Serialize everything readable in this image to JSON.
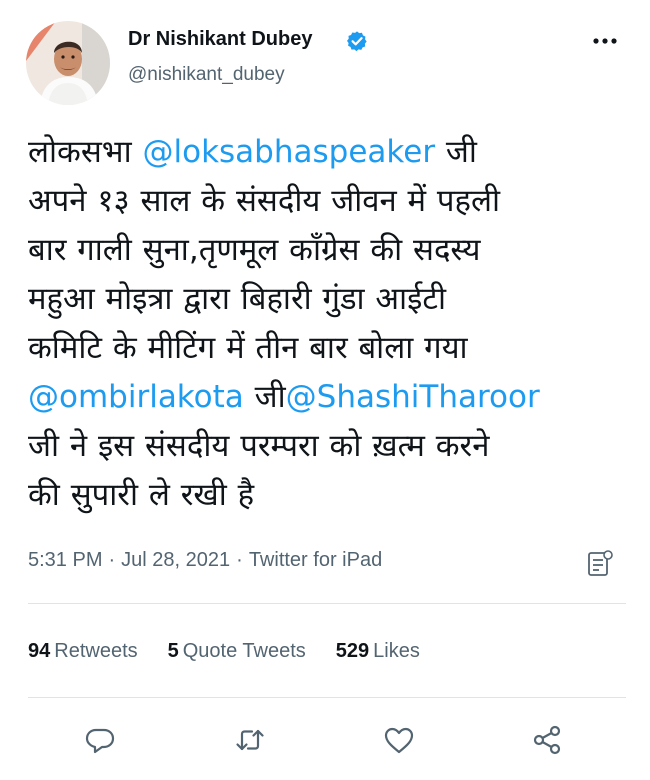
{
  "user": {
    "display_name": "Dr Nishikant Dubey",
    "handle": "@nishikant_dubey",
    "verified": true
  },
  "tweet": {
    "lines": [
      [
        {
          "text": "लोकसभा ",
          "type": "text"
        },
        {
          "text": "@loksabhaspeaker",
          "type": "mention"
        },
        {
          "text": " जी",
          "type": "text"
        }
      ],
      [
        {
          "text": "अपने १३ साल के संसदीय जीवन में पहली",
          "type": "text"
        }
      ],
      [
        {
          "text": "बार गाली सुना,तृणमूल कॉंग्रेस की सदस्य",
          "type": "text"
        }
      ],
      [
        {
          "text": "महुआ मोइत्रा द्वारा बिहारी गुंडा आईटी",
          "type": "text"
        }
      ],
      [
        {
          "text": "कमिटि के मीटिंग में तीन बार बोला गया",
          "type": "text"
        }
      ],
      [
        {
          "text": "@ombirlakota",
          "type": "mention"
        },
        {
          "text": " जी",
          "type": "text"
        },
        {
          "text": "@ShashiTharoor",
          "type": "mention"
        }
      ],
      [
        {
          "text": "जी ने इस संसदीय परम्परा को ख़त्म करने",
          "type": "text"
        }
      ],
      [
        {
          "text": "की सुपारी ले रखी है",
          "type": "text"
        }
      ]
    ],
    "time": "5:31 PM",
    "date": "Jul 28, 2021",
    "source": "Twitter for iPad",
    "separator": "·"
  },
  "stats": {
    "retweets_count": "94",
    "retweets_label": "Retweets",
    "quotes_count": "5",
    "quotes_label": "Quote Tweets",
    "likes_count": "529",
    "likes_label": "Likes"
  },
  "icons": {
    "more": "more-horizontal-icon",
    "verified": "verified-badge-icon",
    "analytics": "analytics-icon",
    "reply": "reply-icon",
    "retweet": "retweet-icon",
    "like": "like-icon",
    "share": "share-icon"
  },
  "colors": {
    "link": "#1d9bf0",
    "secondary_text": "#536471",
    "primary_text": "#0f1419",
    "divider": "#dfe4e8"
  }
}
